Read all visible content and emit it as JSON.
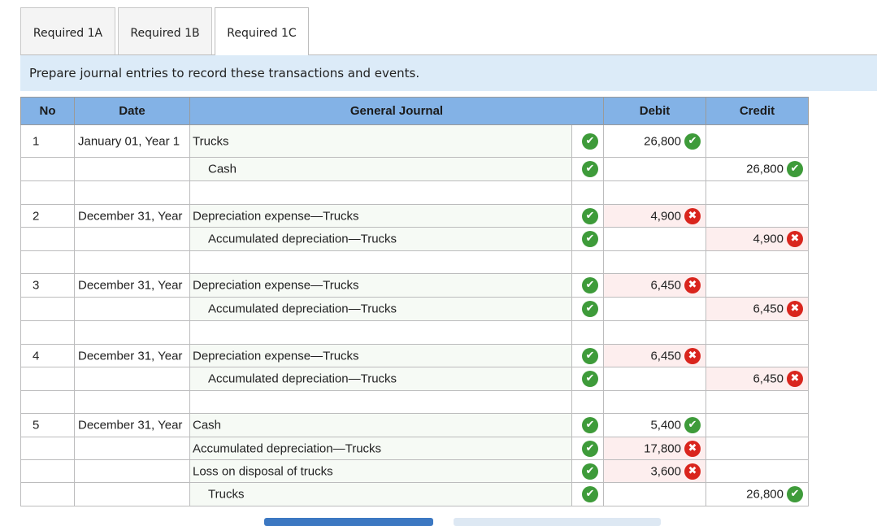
{
  "tabs": [
    {
      "label": "Required 1A"
    },
    {
      "label": "Required 1B"
    },
    {
      "label": "Required 1C"
    }
  ],
  "instruction": "Prepare journal entries to record these transactions and events.",
  "columns": {
    "no": "No",
    "date": "Date",
    "journal": "General Journal",
    "debit": "Debit",
    "credit": "Credit"
  },
  "rows": [
    {
      "no": "1",
      "date": "January 01, Year 1",
      "account": "Trucks",
      "indent": false,
      "check": "ok",
      "debit": "26,800",
      "debit_status": "ok",
      "credit": "",
      "credit_status": ""
    },
    {
      "no": "",
      "date": "",
      "account": "Cash",
      "indent": true,
      "check": "ok",
      "debit": "",
      "debit_status": "",
      "credit": "26,800",
      "credit_status": "ok"
    },
    {
      "blank": true
    },
    {
      "no": "2",
      "date": "December 31, Year",
      "account": "Depreciation expense—Trucks",
      "indent": false,
      "check": "ok",
      "debit": "4,900",
      "debit_status": "bad",
      "credit": "",
      "credit_status": ""
    },
    {
      "no": "",
      "date": "",
      "account": "Accumulated depreciation—Trucks",
      "indent": true,
      "check": "ok",
      "debit": "",
      "debit_status": "",
      "credit": "4,900",
      "credit_status": "bad"
    },
    {
      "blank": true
    },
    {
      "no": "3",
      "date": "December 31, Year",
      "account": "Depreciation expense—Trucks",
      "indent": false,
      "check": "ok",
      "debit": "6,450",
      "debit_status": "bad",
      "credit": "",
      "credit_status": ""
    },
    {
      "no": "",
      "date": "",
      "account": "Accumulated depreciation—Trucks",
      "indent": true,
      "check": "ok",
      "debit": "",
      "debit_status": "",
      "credit": "6,450",
      "credit_status": "bad"
    },
    {
      "blank": true
    },
    {
      "no": "4",
      "date": "December 31, Year",
      "account": "Depreciation expense—Trucks",
      "indent": false,
      "check": "ok",
      "debit": "6,450",
      "debit_status": "bad",
      "credit": "",
      "credit_status": ""
    },
    {
      "no": "",
      "date": "",
      "account": "Accumulated depreciation—Trucks",
      "indent": true,
      "check": "ok",
      "debit": "",
      "debit_status": "",
      "credit": "6,450",
      "credit_status": "bad"
    },
    {
      "blank": true
    },
    {
      "no": "5",
      "date": "December 31, Year",
      "account": "Cash",
      "indent": false,
      "check": "ok",
      "debit": "5,400",
      "debit_status": "ok",
      "credit": "",
      "credit_status": ""
    },
    {
      "no": "",
      "date": "",
      "account": "Accumulated depreciation—Trucks",
      "indent": false,
      "check": "ok",
      "debit": "17,800",
      "debit_status": "bad",
      "credit": "",
      "credit_status": ""
    },
    {
      "no": "",
      "date": "",
      "account": "Loss on disposal of trucks",
      "indent": false,
      "check": "ok",
      "debit": "3,600",
      "debit_status": "bad",
      "credit": "",
      "credit_status": ""
    },
    {
      "no": "",
      "date": "",
      "account": "Trucks",
      "indent": true,
      "check": "ok",
      "debit": "",
      "debit_status": "",
      "credit": "26,800",
      "credit_status": "ok"
    }
  ],
  "icons": {
    "ok": "check-icon",
    "bad": "x-icon"
  },
  "colors": {
    "ok": "#3e9b3a",
    "bad": "#d9251d",
    "header": "#83b2e6",
    "instruction_bg": "#dcebf8"
  }
}
